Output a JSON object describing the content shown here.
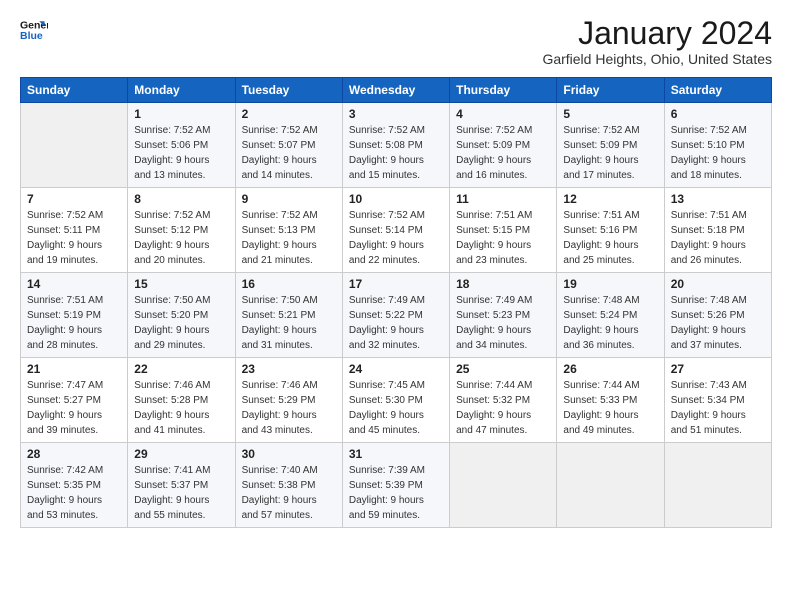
{
  "logo": {
    "line1": "General",
    "line2": "Blue"
  },
  "title": "January 2024",
  "subtitle": "Garfield Heights, Ohio, United States",
  "weekdays": [
    "Sunday",
    "Monday",
    "Tuesday",
    "Wednesday",
    "Thursday",
    "Friday",
    "Saturday"
  ],
  "weeks": [
    [
      {
        "day": "",
        "info": ""
      },
      {
        "day": "1",
        "info": "Sunrise: 7:52 AM\nSunset: 5:06 PM\nDaylight: 9 hours\nand 13 minutes."
      },
      {
        "day": "2",
        "info": "Sunrise: 7:52 AM\nSunset: 5:07 PM\nDaylight: 9 hours\nand 14 minutes."
      },
      {
        "day": "3",
        "info": "Sunrise: 7:52 AM\nSunset: 5:08 PM\nDaylight: 9 hours\nand 15 minutes."
      },
      {
        "day": "4",
        "info": "Sunrise: 7:52 AM\nSunset: 5:09 PM\nDaylight: 9 hours\nand 16 minutes."
      },
      {
        "day": "5",
        "info": "Sunrise: 7:52 AM\nSunset: 5:09 PM\nDaylight: 9 hours\nand 17 minutes."
      },
      {
        "day": "6",
        "info": "Sunrise: 7:52 AM\nSunset: 5:10 PM\nDaylight: 9 hours\nand 18 minutes."
      }
    ],
    [
      {
        "day": "7",
        "info": "Sunrise: 7:52 AM\nSunset: 5:11 PM\nDaylight: 9 hours\nand 19 minutes."
      },
      {
        "day": "8",
        "info": "Sunrise: 7:52 AM\nSunset: 5:12 PM\nDaylight: 9 hours\nand 20 minutes."
      },
      {
        "day": "9",
        "info": "Sunrise: 7:52 AM\nSunset: 5:13 PM\nDaylight: 9 hours\nand 21 minutes."
      },
      {
        "day": "10",
        "info": "Sunrise: 7:52 AM\nSunset: 5:14 PM\nDaylight: 9 hours\nand 22 minutes."
      },
      {
        "day": "11",
        "info": "Sunrise: 7:51 AM\nSunset: 5:15 PM\nDaylight: 9 hours\nand 23 minutes."
      },
      {
        "day": "12",
        "info": "Sunrise: 7:51 AM\nSunset: 5:16 PM\nDaylight: 9 hours\nand 25 minutes."
      },
      {
        "day": "13",
        "info": "Sunrise: 7:51 AM\nSunset: 5:18 PM\nDaylight: 9 hours\nand 26 minutes."
      }
    ],
    [
      {
        "day": "14",
        "info": "Sunrise: 7:51 AM\nSunset: 5:19 PM\nDaylight: 9 hours\nand 28 minutes."
      },
      {
        "day": "15",
        "info": "Sunrise: 7:50 AM\nSunset: 5:20 PM\nDaylight: 9 hours\nand 29 minutes."
      },
      {
        "day": "16",
        "info": "Sunrise: 7:50 AM\nSunset: 5:21 PM\nDaylight: 9 hours\nand 31 minutes."
      },
      {
        "day": "17",
        "info": "Sunrise: 7:49 AM\nSunset: 5:22 PM\nDaylight: 9 hours\nand 32 minutes."
      },
      {
        "day": "18",
        "info": "Sunrise: 7:49 AM\nSunset: 5:23 PM\nDaylight: 9 hours\nand 34 minutes."
      },
      {
        "day": "19",
        "info": "Sunrise: 7:48 AM\nSunset: 5:24 PM\nDaylight: 9 hours\nand 36 minutes."
      },
      {
        "day": "20",
        "info": "Sunrise: 7:48 AM\nSunset: 5:26 PM\nDaylight: 9 hours\nand 37 minutes."
      }
    ],
    [
      {
        "day": "21",
        "info": "Sunrise: 7:47 AM\nSunset: 5:27 PM\nDaylight: 9 hours\nand 39 minutes."
      },
      {
        "day": "22",
        "info": "Sunrise: 7:46 AM\nSunset: 5:28 PM\nDaylight: 9 hours\nand 41 minutes."
      },
      {
        "day": "23",
        "info": "Sunrise: 7:46 AM\nSunset: 5:29 PM\nDaylight: 9 hours\nand 43 minutes."
      },
      {
        "day": "24",
        "info": "Sunrise: 7:45 AM\nSunset: 5:30 PM\nDaylight: 9 hours\nand 45 minutes."
      },
      {
        "day": "25",
        "info": "Sunrise: 7:44 AM\nSunset: 5:32 PM\nDaylight: 9 hours\nand 47 minutes."
      },
      {
        "day": "26",
        "info": "Sunrise: 7:44 AM\nSunset: 5:33 PM\nDaylight: 9 hours\nand 49 minutes."
      },
      {
        "day": "27",
        "info": "Sunrise: 7:43 AM\nSunset: 5:34 PM\nDaylight: 9 hours\nand 51 minutes."
      }
    ],
    [
      {
        "day": "28",
        "info": "Sunrise: 7:42 AM\nSunset: 5:35 PM\nDaylight: 9 hours\nand 53 minutes."
      },
      {
        "day": "29",
        "info": "Sunrise: 7:41 AM\nSunset: 5:37 PM\nDaylight: 9 hours\nand 55 minutes."
      },
      {
        "day": "30",
        "info": "Sunrise: 7:40 AM\nSunset: 5:38 PM\nDaylight: 9 hours\nand 57 minutes."
      },
      {
        "day": "31",
        "info": "Sunrise: 7:39 AM\nSunset: 5:39 PM\nDaylight: 9 hours\nand 59 minutes."
      },
      {
        "day": "",
        "info": ""
      },
      {
        "day": "",
        "info": ""
      },
      {
        "day": "",
        "info": ""
      }
    ]
  ]
}
